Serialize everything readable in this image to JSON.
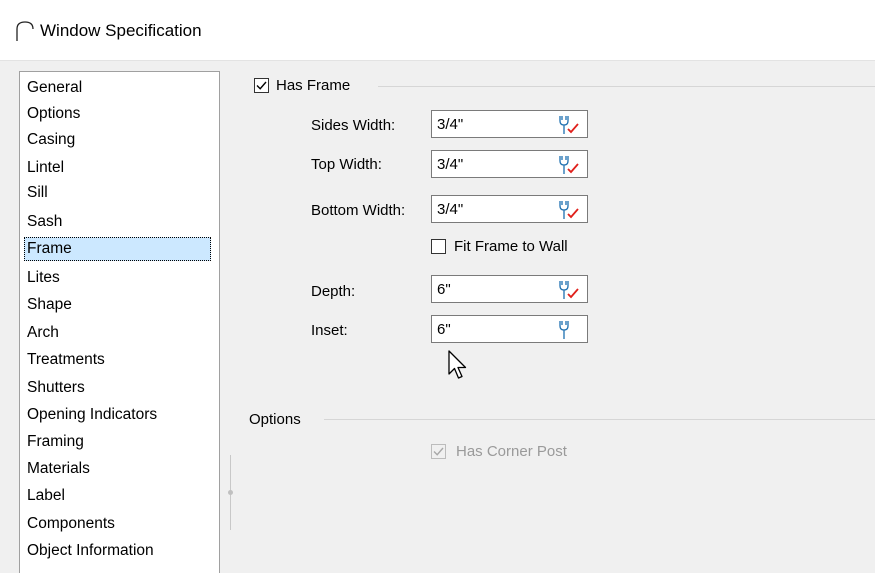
{
  "window": {
    "title": "Window Specification"
  },
  "nav": {
    "items": [
      {
        "label": "General"
      },
      {
        "label": "Options"
      },
      {
        "label": "Casing"
      },
      {
        "label": "Lintel"
      },
      {
        "label": "Sill"
      },
      {
        "label": "Sash"
      },
      {
        "label": "Frame",
        "selected": true
      },
      {
        "label": "Lites"
      },
      {
        "label": "Shape"
      },
      {
        "label": "Arch"
      },
      {
        "label": "Treatments"
      },
      {
        "label": "Shutters"
      },
      {
        "label": "Opening Indicators"
      },
      {
        "label": "Framing"
      },
      {
        "label": "Materials"
      },
      {
        "label": "Label"
      },
      {
        "label": "Components"
      },
      {
        "label": "Object Information"
      }
    ]
  },
  "frame": {
    "has_frame_label": "Has Frame",
    "has_frame_checked": true,
    "sides_width_label": "Sides Width:",
    "sides_width_value": "3/4\"",
    "top_width_label": "Top Width:",
    "top_width_value": "3/4\"",
    "bottom_width_label": "Bottom Width:",
    "bottom_width_value": "3/4\"",
    "fit_frame_label": "Fit Frame to Wall",
    "fit_frame_checked": false,
    "depth_label": "Depth:",
    "depth_value": "6\"",
    "inset_label": "Inset:",
    "inset_value": "6\""
  },
  "options": {
    "group_label": "Options",
    "has_corner_post_label": "Has Corner Post",
    "has_corner_post_checked": true,
    "has_corner_post_enabled": false
  },
  "icons": {
    "window": "arch-window-icon",
    "tool": "wrench-icon",
    "check": "checkmark-icon",
    "cursor": "mouse-pointer-icon"
  },
  "colors": {
    "selection": "#cce8ff",
    "override_check": "#e0201b",
    "dialog_bg": "#f0f0f0"
  }
}
